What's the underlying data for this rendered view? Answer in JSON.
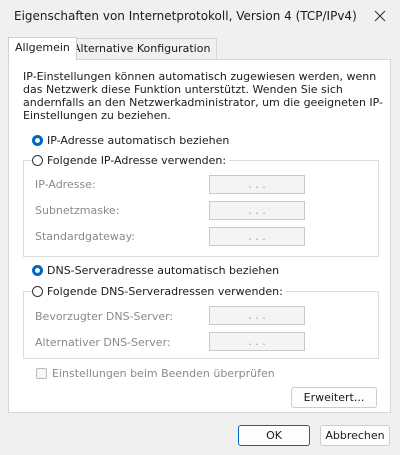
{
  "window": {
    "title": "Eigenschaften von Internetprotokoll, Version 4 (TCP/IPv4)"
  },
  "tabs": [
    {
      "label": "Allgemein",
      "active": true
    },
    {
      "label": "Alternative Konfiguration",
      "active": false
    }
  ],
  "description": "IP-Einstellungen können automatisch zugewiesen werden, wenn das Netzwerk diese Funktion unterstützt. Wenden Sie sich andernfalls an den Netzwerkadministrator, um die geeigneten IP-Einstellungen zu beziehen.",
  "ip": {
    "auto_label": "IP-Adresse automatisch beziehen",
    "manual_label": "Folgende IP-Adresse verwenden:",
    "fields": [
      {
        "label": "IP-Adresse:",
        "value": ". . ."
      },
      {
        "label": "Subnetzmaske:",
        "value": ". . ."
      },
      {
        "label": "Standardgateway:",
        "value": ". . ."
      }
    ]
  },
  "dns": {
    "auto_label": "DNS-Serveradresse automatisch beziehen",
    "manual_label": "Folgende DNS-Serveradressen verwenden:",
    "fields": [
      {
        "label": "Bevorzugter DNS-Server:",
        "value": ". . ."
      },
      {
        "label": "Alternativer DNS-Server:",
        "value": ". . ."
      }
    ]
  },
  "validate_label": "Einstellungen beim Beenden überprüfen",
  "buttons": {
    "advanced": "Erweitert...",
    "ok": "OK",
    "cancel": "Abbrechen"
  },
  "colors": {
    "accent": "#0067c0"
  }
}
